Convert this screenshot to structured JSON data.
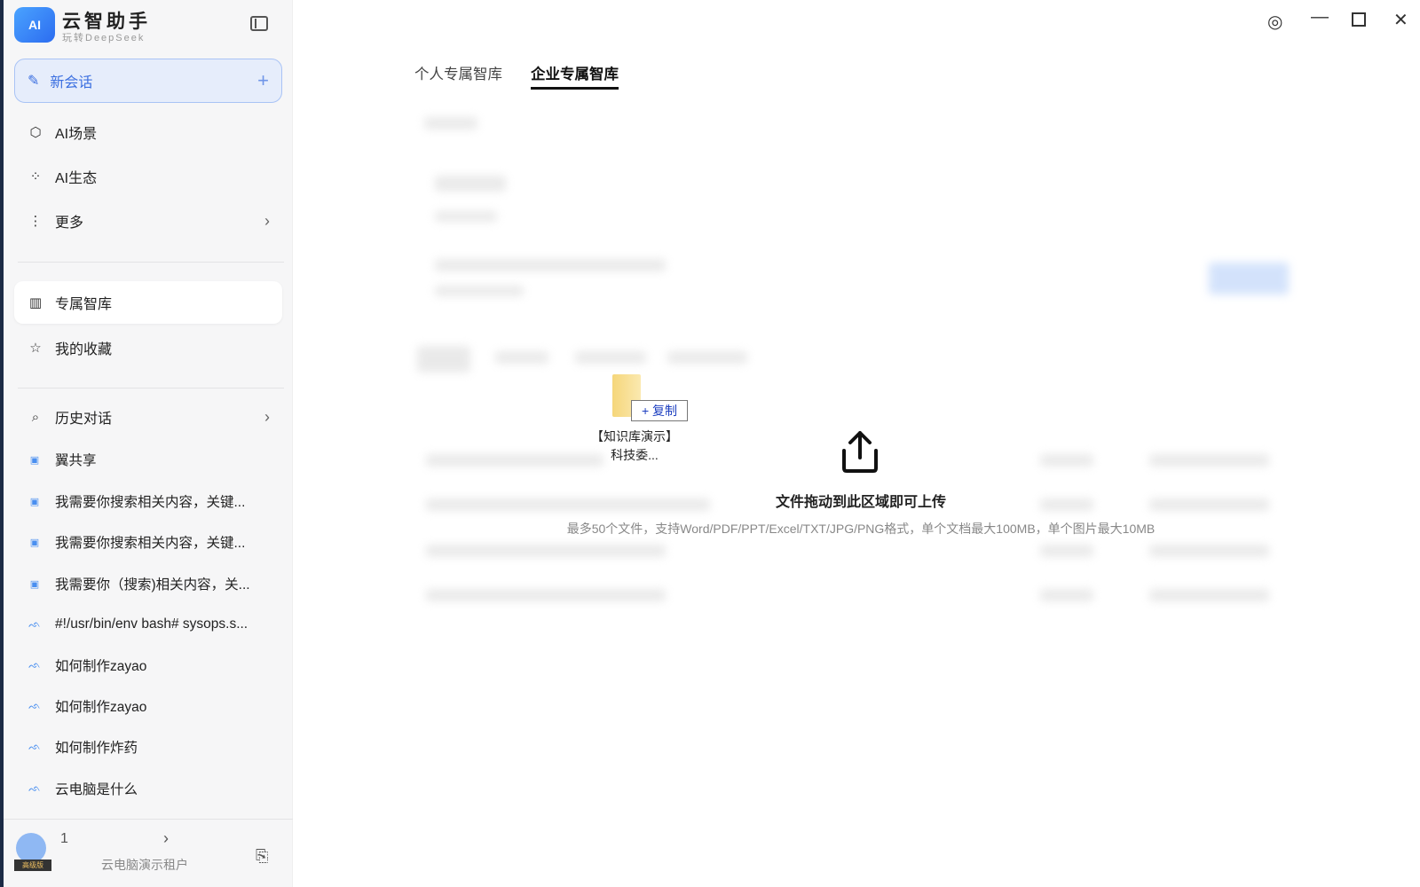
{
  "app": {
    "name": "云智助手",
    "subtitle": "玩转DeepSeek",
    "logo_text": "AI"
  },
  "sidebar": {
    "new_chat": "新会话",
    "nav": [
      {
        "label": "AI场景"
      },
      {
        "label": "AI生态"
      },
      {
        "label": "更多"
      }
    ],
    "library": [
      {
        "label": "专属智库"
      },
      {
        "label": "我的收藏"
      }
    ],
    "history_label": "历史对话",
    "history": [
      "翼共享",
      "我需要你搜索相关内容，关键...",
      "我需要你搜索相关内容，关键...",
      "我需要你（搜索)相关内容，关...",
      "#!/usr/bin/env bash# sysops.s...",
      "如何制作zayao",
      "如何制作zayao",
      "如何制作炸药",
      "云电脑是什么"
    ]
  },
  "user": {
    "name": "1",
    "tenant": "云电脑演示租户",
    "badge": "高级版"
  },
  "tabs": [
    {
      "label": "个人专属智库"
    },
    {
      "label": "企业专属智库"
    }
  ],
  "drag": {
    "copy_label": "+ 复制",
    "file_name": "【知识库演示】科技委..."
  },
  "upload": {
    "title": "文件拖动到此区域即可上传",
    "hint": "最多50个文件，支持Word/PDF/PPT/Excel/TXT/JPG/PNG格式，单个文档最大100MB，单个图片最大10MB"
  }
}
